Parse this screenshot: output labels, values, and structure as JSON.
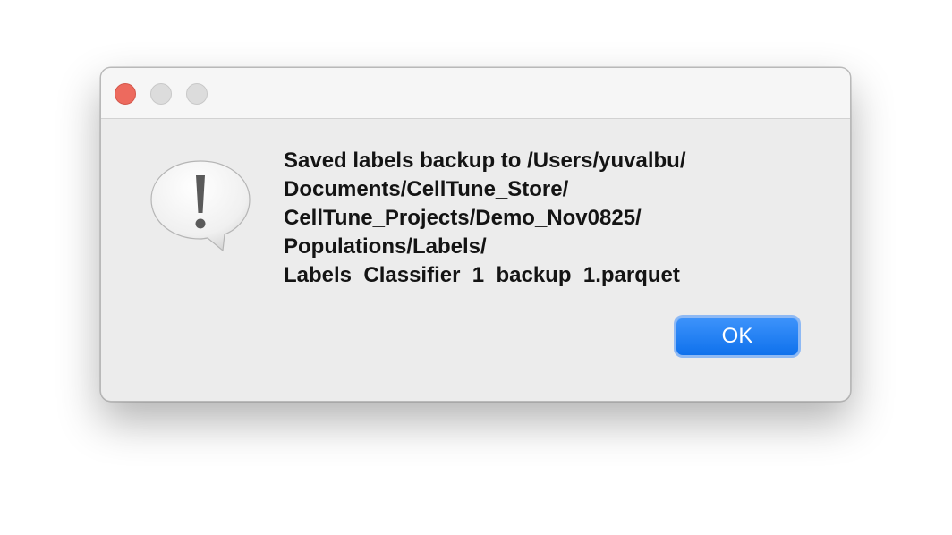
{
  "dialog": {
    "message_lines": [
      "Saved labels backup to /Users/yuvalbu/",
      "Documents/CellTune_Store/",
      "CellTune_Projects/Demo_Nov0825/",
      "Populations/Labels/",
      "Labels_Classifier_1_backup_1.parquet"
    ],
    "ok_label": "OK",
    "icon": "alert-speech-bubble-icon"
  },
  "window_controls": {
    "close": "close-icon",
    "minimize": "minimize-icon",
    "zoom": "zoom-icon"
  },
  "colors": {
    "accent": "#0f71ec",
    "close_button": "#ed6a5e",
    "dialog_background": "#ececec"
  }
}
